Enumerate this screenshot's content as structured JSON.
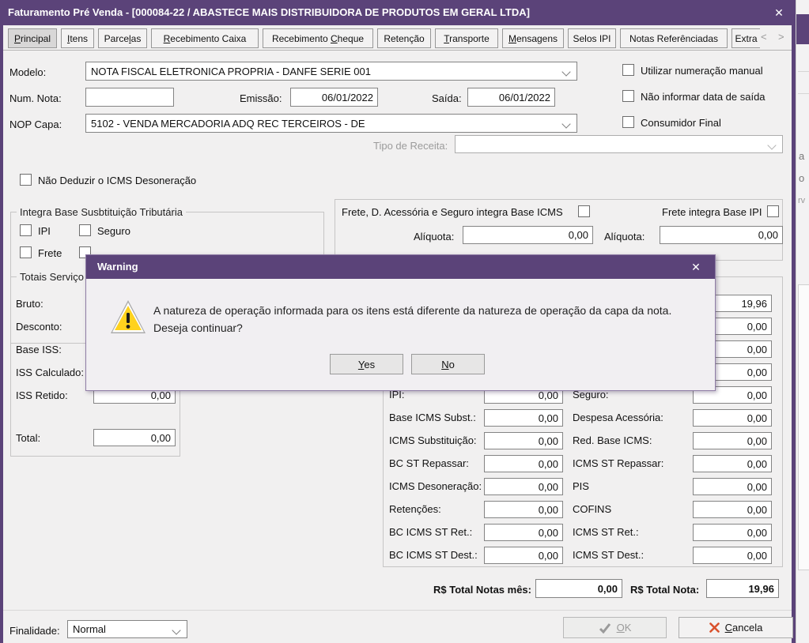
{
  "colors": {
    "titlebar_purple": "#5b4379",
    "warning_yellow": "#ffd21e",
    "cancel_red": "#d9512c"
  },
  "window": {
    "title": "Faturamento Pré Venda - [000084-22 / ABASTECE MAIS DISTRIBUIDORA DE PRODUTOS EM GERAL LTDA]",
    "close_glyph": "✕"
  },
  "tabs": [
    {
      "label": "Principal",
      "mnemonic": "P"
    },
    {
      "label": "Itens",
      "mnemonic": "I"
    },
    {
      "label": "Parcelas",
      "mnemonic": "l"
    },
    {
      "label": "Recebimento Caixa",
      "mnemonic": "R"
    },
    {
      "label": "Recebimento Cheque",
      "mnemonic": "C"
    },
    {
      "label": "Retenção",
      "mnemonic": ""
    },
    {
      "label": "Transporte",
      "mnemonic": "T"
    },
    {
      "label": "Mensagens",
      "mnemonic": "M"
    },
    {
      "label": "Selos IPI",
      "mnemonic": ""
    },
    {
      "label": "Notas Referênciadas",
      "mnemonic": ""
    },
    {
      "label": "Extra",
      "mnemonic": ""
    }
  ],
  "tab_scroll": {
    "prev": "<",
    "next": ">"
  },
  "form": {
    "modelo": {
      "label": "Modelo:",
      "value": "NOTA FISCAL ELETRONICA PROPRIA - DANFE SERIE 001"
    },
    "num_nota": {
      "label": "Num. Nota:",
      "value": ""
    },
    "emissao": {
      "label": "Emissão:",
      "value": "06/01/2022"
    },
    "saida": {
      "label": "Saída:",
      "value": "06/01/2022"
    },
    "nop_capa": {
      "label": "NOP Capa:",
      "value": "5102 - VENDA MERCADORIA ADQ REC TERCEIROS - DE"
    },
    "tipo_receita": {
      "label": "Tipo de Receita:",
      "value": ""
    },
    "chk_manual": "Utilizar numeração manual",
    "chk_sem_saida": "Não informar data de saída",
    "chk_consumidor": "Consumidor Final",
    "chk_nao_deduzir": "Não Deduzir o ICMS Desoneração"
  },
  "integra_group": {
    "title": "Integra Base Susbtituição Tributária",
    "ipi": "IPI",
    "seguro": "Seguro",
    "frete": "Frete"
  },
  "frete_group": {
    "icms_checkbox_label": "Frete, D. Acessória e Seguro integra Base ICMS",
    "ipi_checkbox_label": "Frete integra Base IPI",
    "aliquota_icms": {
      "label": "Alíquota:",
      "value": "0,00"
    },
    "aliquota_ipi": {
      "label": "Alíquota:",
      "value": "0,00"
    }
  },
  "totais_servico": {
    "title": "Totais Serviço",
    "rows": [
      {
        "label": "Bruto:",
        "value": ""
      },
      {
        "label": "Desconto:",
        "value": ""
      },
      {
        "label": "Base ISS:",
        "value": ""
      },
      {
        "label": "ISS Calculado:",
        "value": ""
      },
      {
        "label": "ISS Retido:",
        "value": "0,00"
      },
      {
        "label": "Total:",
        "value": "0,00"
      }
    ]
  },
  "tax_panel": {
    "right_top_values": [
      "19,96",
      "0,00",
      "0,00",
      "0,00"
    ],
    "middle_rows": [
      {
        "label": "IPI:",
        "value": "0,00"
      },
      {
        "label": "Base ICMS Subst.:",
        "value": "0,00"
      },
      {
        "label": "ICMS Substituição:",
        "value": "0,00"
      },
      {
        "label": "BC ST Repassar:",
        "value": "0,00"
      },
      {
        "label": "ICMS Desoneração:",
        "value": "0,00"
      },
      {
        "label": "Retenções:",
        "value": "0,00"
      },
      {
        "label": "BC ICMS ST Ret.:",
        "value": "0,00"
      },
      {
        "label": "BC ICMS ST Dest.:",
        "value": "0,00"
      }
    ],
    "right_rows": [
      {
        "label": "Seguro:",
        "value": "0,00"
      },
      {
        "label": "Despesa Acessória:",
        "value": "0,00"
      },
      {
        "label": "Red. Base ICMS:",
        "value": "0,00"
      },
      {
        "label": "ICMS ST Repassar:",
        "value": "0,00"
      },
      {
        "label": "PIS",
        "value": "0,00"
      },
      {
        "label": "COFINS",
        "value": "0,00"
      },
      {
        "label": "ICMS ST Ret.:",
        "value": "0,00"
      },
      {
        "label": "ICMS ST Dest.:",
        "value": "0,00"
      }
    ]
  },
  "totals": {
    "month_label": "R$ Total Notas mês:",
    "month_value": "0,00",
    "nota_label": "R$ Total Nota:",
    "nota_value": "19,96"
  },
  "footer": {
    "finalidade_label": "Finalidade:",
    "finalidade_value": "Normal",
    "ok": {
      "label": "OK",
      "mnemonic": "O"
    },
    "cancela": {
      "label": "Cancela",
      "mnemonic": "C"
    }
  },
  "warning_dialog": {
    "title": "Warning",
    "close_glyph": "✕",
    "message_line1": "A natureza de operação informada para os itens está diferente da natureza de operação da capa da nota.",
    "message_line2": "Deseja continuar?",
    "yes": {
      "label": "Yes",
      "mnemonic": "Y"
    },
    "no": {
      "label": "No",
      "mnemonic": "N"
    }
  },
  "background_window": {
    "fragments": [
      "a",
      "o",
      "rv",
      "a",
      "o"
    ]
  }
}
